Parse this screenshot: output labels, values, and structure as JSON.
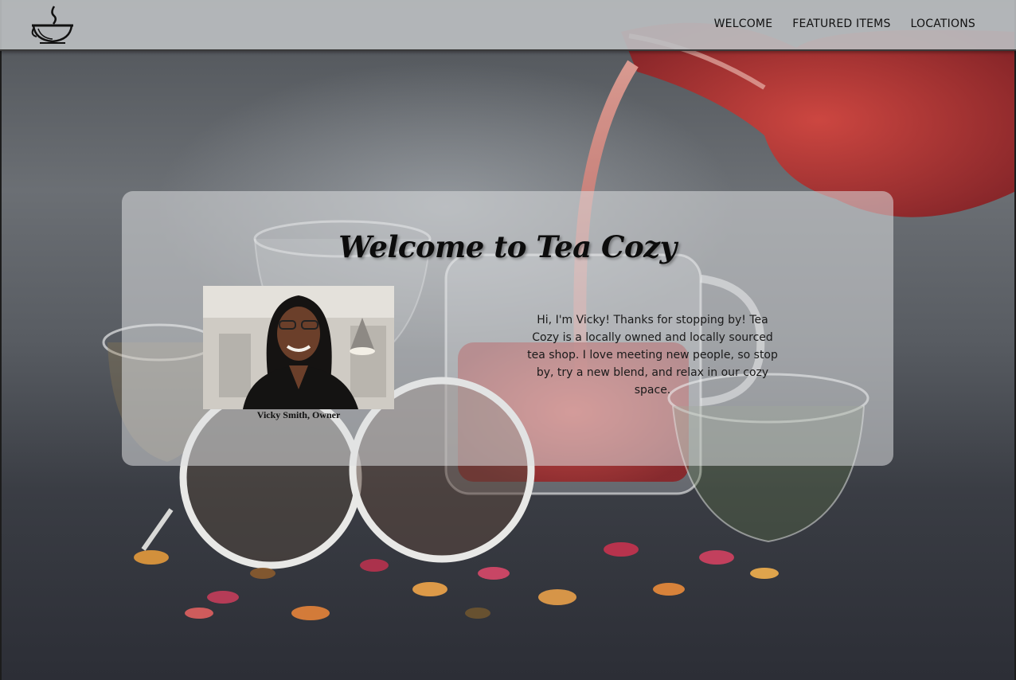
{
  "navbar": {
    "logo_icon": "teacup-icon",
    "links": [
      {
        "label": "WELCOME"
      },
      {
        "label": "FEATURED ITEMS"
      },
      {
        "label": "LOCATIONS"
      }
    ]
  },
  "hero": {
    "background_icon": "tea-pour-photo",
    "title": "Welcome to Tea Cozy",
    "portrait_caption": "Vicky Smith, Owner",
    "intro": "Hi, I'm Vicky! Thanks for stopping by! Tea Cozy is a locally owned and locally sourced tea shop. I love meeting new people, so stop by, try a new blend, and relax in our cozy space."
  },
  "colors": {
    "nav_background": "#bcc0c2",
    "card_background": "#dcdee0",
    "text": "#111111"
  }
}
